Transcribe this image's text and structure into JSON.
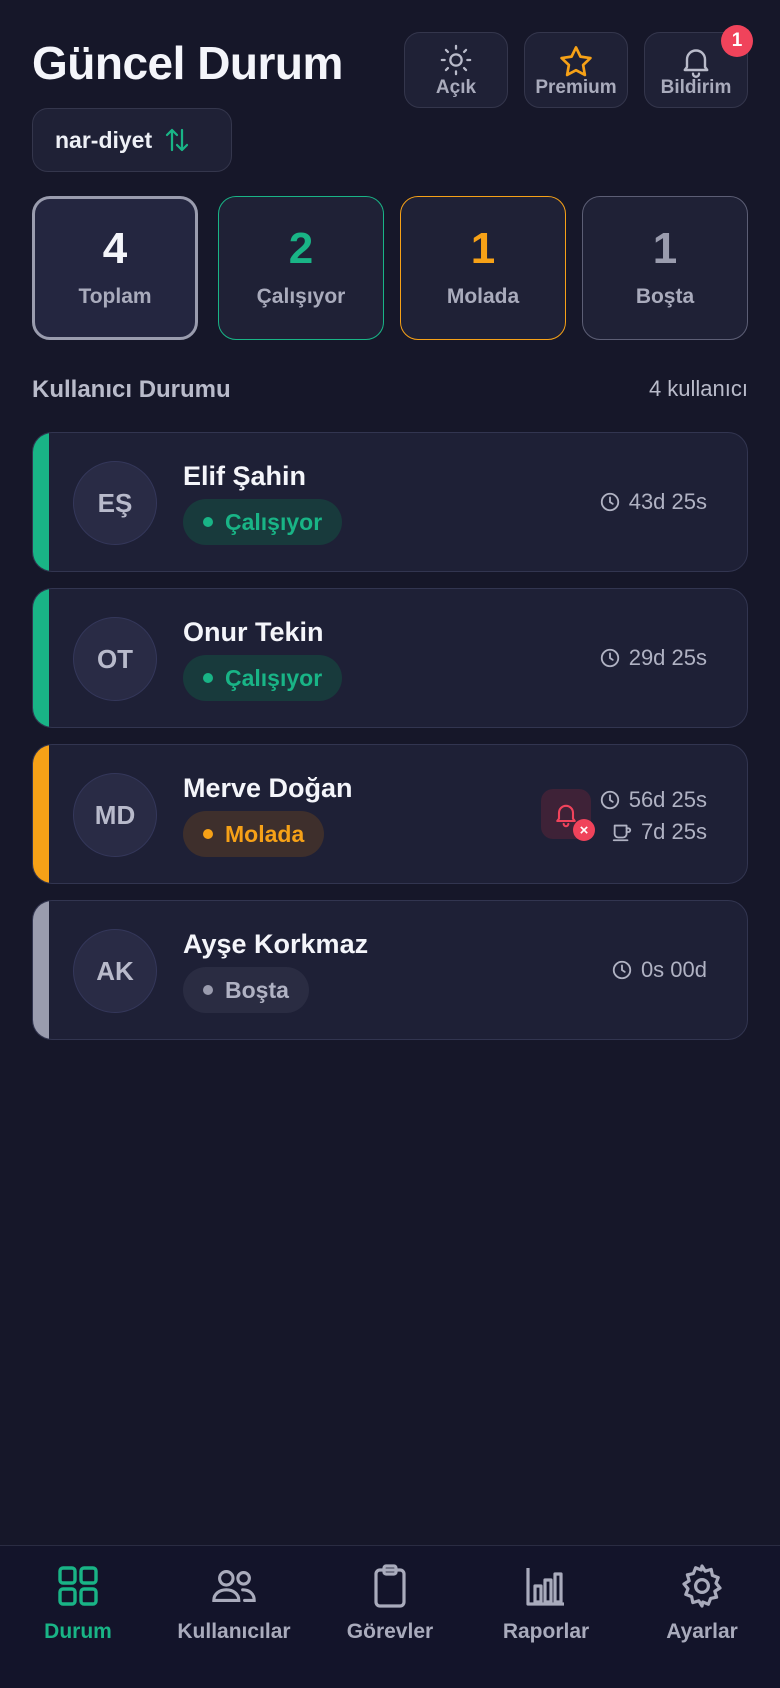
{
  "header": {
    "title": "Güncel Durum",
    "buttons": [
      {
        "label": "Açık",
        "icon": "sun-icon"
      },
      {
        "label": "Premium",
        "icon": "star-icon"
      },
      {
        "label": "Bildirim",
        "icon": "bell-icon",
        "badge": "1"
      }
    ]
  },
  "workspace": {
    "name": "nar-diyet",
    "icon": "swap-vertical-icon"
  },
  "stats": [
    {
      "value": "4",
      "label": "Toplam",
      "color": "#f4f5fa"
    },
    {
      "value": "2",
      "label": "Çalışıyor",
      "color": "#19b486"
    },
    {
      "value": "1",
      "label": "Molada",
      "color": "#f6a117"
    },
    {
      "value": "1",
      "label": "Boşta",
      "color": "#9a9cae"
    }
  ],
  "section": {
    "title": "Kullanıcı Durumu",
    "count": "4 kullanıcı"
  },
  "users": [
    {
      "initials": "EŞ",
      "name": "Elif Şahin",
      "status": "Çalışıyor",
      "time": "43d 25s"
    },
    {
      "initials": "OT",
      "name": "Onur Tekin",
      "status": "Çalışıyor",
      "time": "29d 25s"
    },
    {
      "initials": "MD",
      "name": "Merve Doğan",
      "status": "Molada",
      "time": "56d 25s",
      "break_time": "7d 25s",
      "alert": "×"
    },
    {
      "initials": "AK",
      "name": "Ayşe Korkmaz",
      "status": "Boşta",
      "time": "0s 00d"
    }
  ],
  "colors": {
    "working": "#19b486",
    "break": "#f6a117",
    "idle": "#9a9cae",
    "background": "#161729",
    "alert": "#f0435b"
  },
  "nav": [
    {
      "label": "Durum",
      "icon": "grid-icon",
      "active": true
    },
    {
      "label": "Kullanıcılar",
      "icon": "users-icon"
    },
    {
      "label": "Görevler",
      "icon": "clipboard-icon"
    },
    {
      "label": "Raporlar",
      "icon": "bar-chart-icon"
    },
    {
      "label": "Ayarlar",
      "icon": "gear-icon"
    }
  ]
}
